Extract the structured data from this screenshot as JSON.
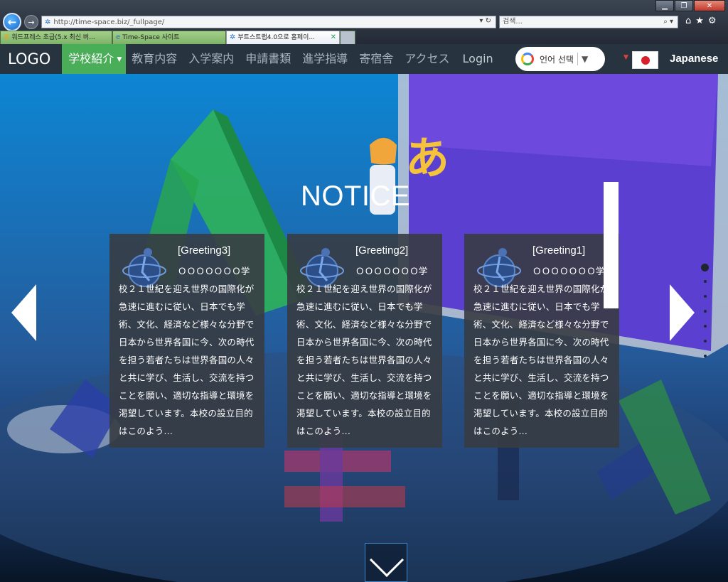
{
  "browser": {
    "url": "http://time-space.biz/_fullpage/",
    "search_placeholder": "검색...",
    "tabs": [
      {
        "label": "워드프레스 초급(5.x 최신 버..."
      },
      {
        "label": "Time-Space 사이트"
      },
      {
        "label": "부트스트랩4.0으로 홈페이..."
      }
    ],
    "window": {
      "minimize": "▁",
      "restore": "❐",
      "close": "✕"
    }
  },
  "nav": {
    "logo": "LOGO",
    "items": [
      {
        "label": "学校紹介"
      },
      {
        "label": "教育内容"
      },
      {
        "label": "入学案内"
      },
      {
        "label": "申請書類"
      },
      {
        "label": "進学指導"
      },
      {
        "label": "寄宿舎"
      },
      {
        "label": "アクセス"
      },
      {
        "label": "Login"
      }
    ],
    "translate_label": "언어 선택",
    "language": "Japanese"
  },
  "hero": {
    "title": "NOTICE",
    "cards": [
      {
        "title": "[Greeting3]",
        "body": "ＯＯＯＯＯＯＯ学校２１世紀を迎え世界の国際化が急速に進むに従い、日本でも学術、文化、経済など様々な分野で日本から世界各国に今、次の時代を担う若者たちは世界各国の人々と共に学び、生活し、交流を持つことを願い、適切な指導と環境を渇望しています。本校の設立目的はこのよう..."
      },
      {
        "title": "[Greeting2]",
        "body": "ＯＯＯＯＯＯＯ学校２１世紀を迎え世界の国際化が急速に進むに従い、日本でも学術、文化、経済など様々な分野で日本から世界各国に今、次の時代を担う若者たちは世界各国の人々と共に学び、生活し、交流を持つことを願い、適切な指導と環境を渇望しています。本校の設立目的はこのよう..."
      },
      {
        "title": "[Greeting1]",
        "body": "ＯＯＯＯＯＯＯ学校２１世紀を迎え世界の国際化が急速に進むに従い、日本でも学術、文化、経済など様々な分野で日本から世界各国に今、次の時代を担う若者たちは世界各国の人々と共に学び、生活し、交流を持つことを願い、適切な指導と環境を渇望しています。本校の設立目的はこのよう..."
      }
    ],
    "art_glyph": "あ"
  }
}
